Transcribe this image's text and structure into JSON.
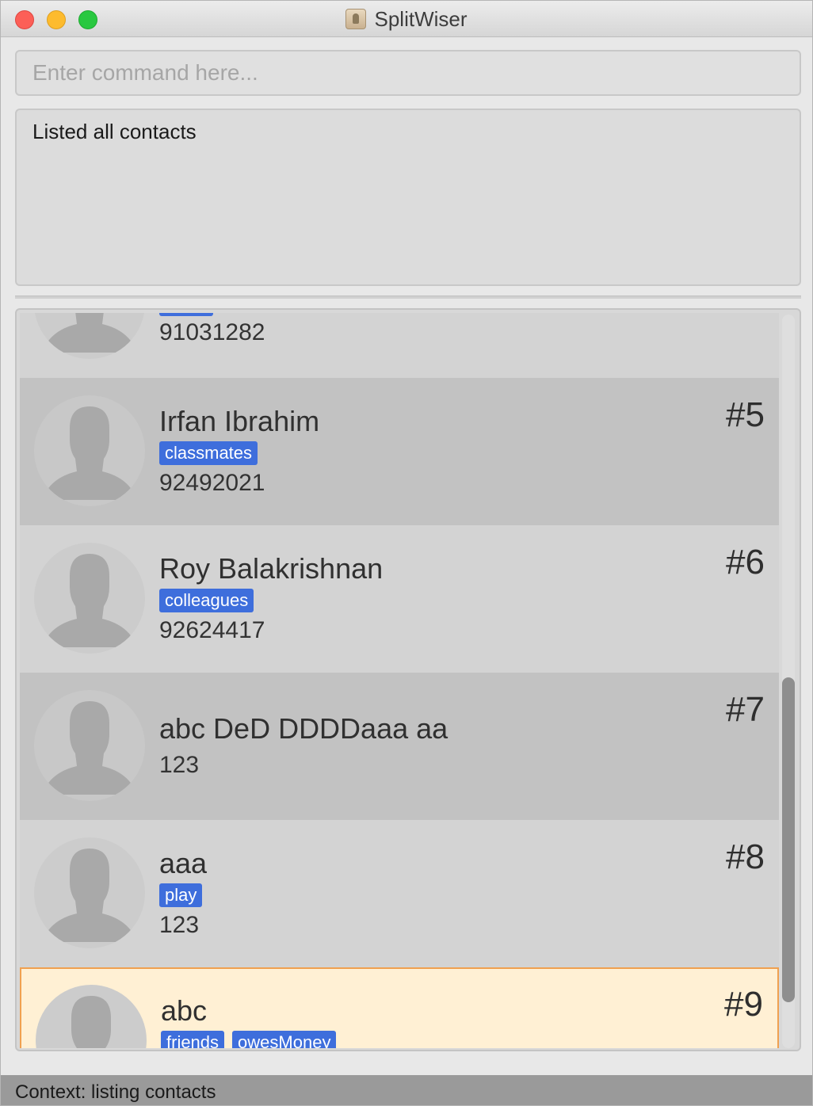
{
  "window": {
    "title": "SplitWiser"
  },
  "command": {
    "placeholder": "Enter command here..."
  },
  "result": {
    "message": "Listed all contacts"
  },
  "contacts": [
    {
      "name": "",
      "tags": [
        ""
      ],
      "phone": "91031282",
      "index": ""
    },
    {
      "name": "Irfan Ibrahim",
      "tags": [
        "classmates"
      ],
      "phone": "92492021",
      "index": "#5"
    },
    {
      "name": "Roy Balakrishnan",
      "tags": [
        "colleagues"
      ],
      "phone": "92624417",
      "index": "#6"
    },
    {
      "name": "abc DeD DDDDaaa aa",
      "tags": [],
      "phone": "123",
      "index": "#7"
    },
    {
      "name": "aaa",
      "tags": [
        "play"
      ],
      "phone": "123",
      "index": "#8"
    },
    {
      "name": "abc",
      "tags": [
        "friends",
        "owesMoney"
      ],
      "phone": "",
      "index": "#9"
    }
  ],
  "colors": {
    "tag": "#3e6edc",
    "selected_bg": "#fff0d4",
    "selected_border": "#f0a050"
  },
  "icons": {
    "avatar": "person-silhouette-icon",
    "app": "app-icon"
  },
  "status": {
    "context": "Context: listing contacts"
  }
}
